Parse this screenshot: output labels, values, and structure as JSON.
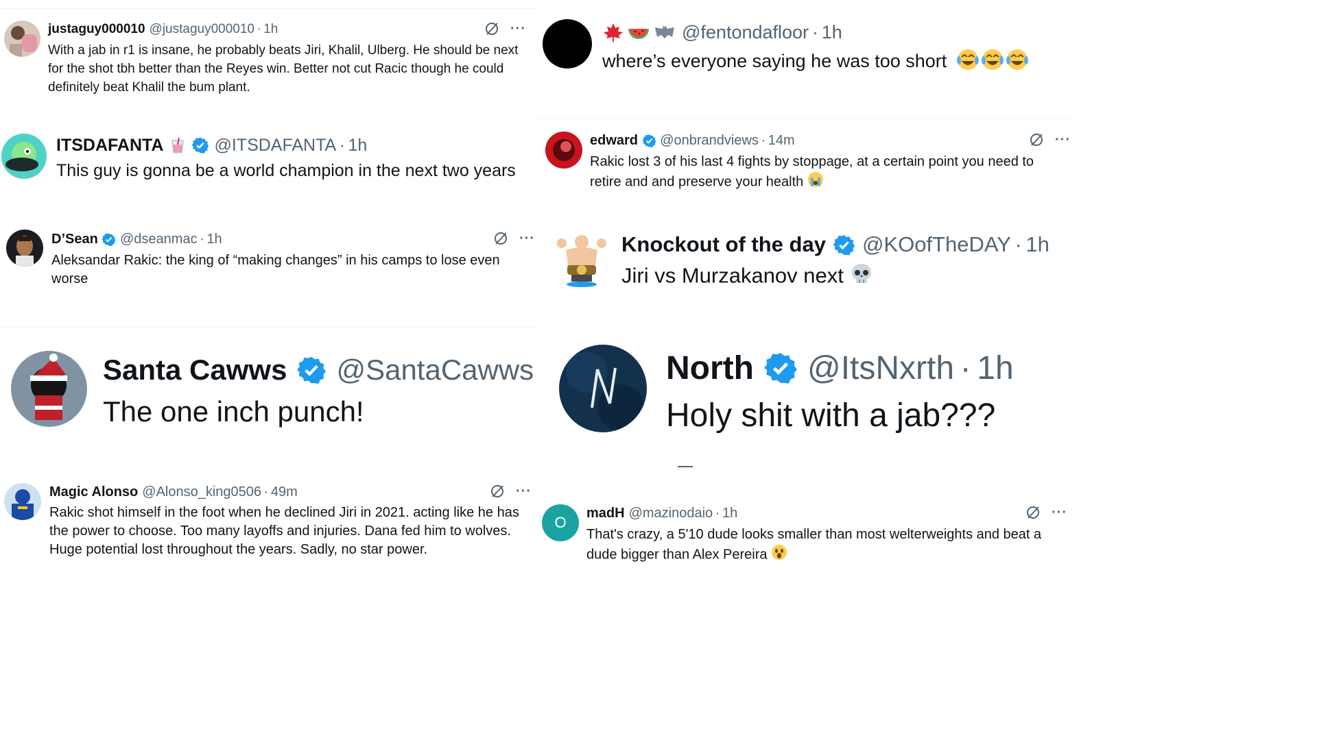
{
  "tweets": [
    {
      "name": "justaguy000010",
      "handle": "@justaguy000010",
      "time": "1h",
      "text": "With a jab in r1 is insane, he probably beats Jiri, Khalil, Ulberg. He should be next for the shot tbh better than the Reyes win. Better not cut Racic though he could definitely beat Khalil the bum plant."
    },
    {
      "name": "ITSDAFANTA",
      "handle": "@ITSDAFANTA",
      "time": "1h",
      "text": "This guy is gonna be a world champion in the next two years"
    },
    {
      "name": "D’Sean",
      "handle": "@dseanmac",
      "time": "1h",
      "text": "Aleksandar Rakic: the king of “making changes” in his camps to lose even worse"
    },
    {
      "name": "Santa Cawws",
      "handle": "@SantaCawws",
      "time": "",
      "text": "The one inch punch!"
    },
    {
      "name": "Magic Alonso",
      "handle": "@Alonso_king0506",
      "time": "49m",
      "text": "Rakic shot himself in the foot when he declined Jiri in 2021. acting like he has the power to choose. Too many layoffs and injuries. Dana fed him to wolves. Huge potential lost throughout the years. Sadly, no star power."
    },
    {
      "name": "",
      "handle": "@fentondafloor",
      "time": "1h",
      "text": "where’s everyone saying he was too short"
    },
    {
      "name": "edward",
      "handle": "@onbrandviews",
      "time": "14m",
      "text": "Rakic lost 3 of his last 4 fights by stoppage, at a certain point you need to retire and and preserve your health"
    },
    {
      "name": "Knockout of the day",
      "handle": "@KOofTheDAY",
      "time": "1h",
      "text": "Jiri vs Murzakanov next"
    },
    {
      "name": "North",
      "handle": "@ItsNxrth",
      "time": "1h",
      "text": "Holy shit with a jab???"
    },
    {
      "name": "madH",
      "handle": "@mazinodaio",
      "time": "1h",
      "text": "That's crazy, a 5'10 dude looks smaller than most welterweights and beat a dude bigger than Alex Pereira",
      "avatar_letter": "O"
    }
  ],
  "separator": "·",
  "more_label": "···",
  "colors": {
    "verified": "#1d9bf0",
    "secondary_text": "#536471",
    "madh_avatar": "#1aa3a3"
  },
  "icons": [
    "verified-badge-icon",
    "grok-icon",
    "more-icon",
    "tears-of-joy-emoji",
    "crying-emoji",
    "skull-emoji",
    "astonished-emoji"
  ]
}
